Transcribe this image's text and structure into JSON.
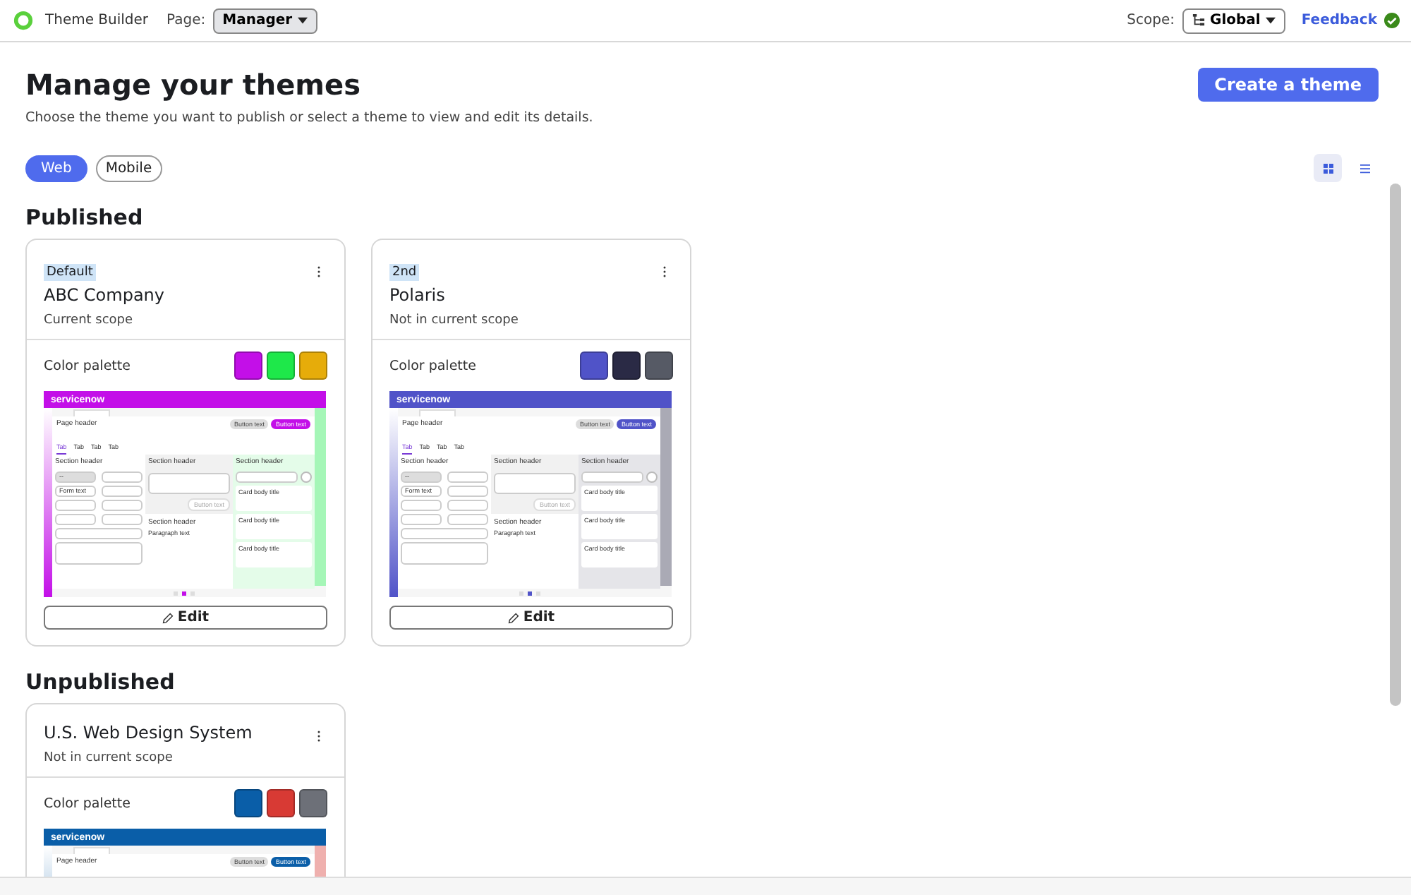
{
  "topbar": {
    "app_name": "Theme Builder",
    "page_label": "Page:",
    "page_value": "Manager",
    "scope_label": "Scope:",
    "scope_value": "Global",
    "feedback": "Feedback"
  },
  "header": {
    "title": "Manage your themes",
    "subtitle": "Choose the theme you want to publish or select a theme to view and edit its details.",
    "create_button": "Create a theme"
  },
  "platform_tabs": [
    {
      "label": "Web",
      "selected": true
    },
    {
      "label": "Mobile",
      "selected": false
    }
  ],
  "view_toggle": [
    {
      "kind": "grid",
      "selected": true
    },
    {
      "kind": "list",
      "selected": false
    }
  ],
  "sections": [
    {
      "title": "Published",
      "themes": [
        {
          "badge": "Default",
          "name": "ABC Company",
          "scope": "Current scope",
          "palette_label": "Color palette",
          "palette": [
            {
              "color": "#c30fe8"
            },
            {
              "color": "#1ee84a"
            },
            {
              "color": "#e6ac0a"
            }
          ],
          "preview": {
            "brand": "servicenow",
            "page_header": "Page header",
            "header_buttons": [
              "Button text",
              "Button text"
            ],
            "tabs": [
              "Tab",
              "Tab",
              "Tab",
              "Tab"
            ],
            "section_headers": [
              "Section header",
              "Section header",
              "Section header",
              "Section header"
            ],
            "field_value": "--",
            "form_text": "Form text",
            "button": "Button text",
            "paragraph": "Paragraph text",
            "card_titles": [
              "Card body title",
              "Card body title",
              "Card body title"
            ]
          },
          "edit": "Edit"
        },
        {
          "badge": "2nd",
          "name": "Polaris",
          "scope": "Not in current scope",
          "palette_label": "Color palette",
          "palette": [
            {
              "color": "#5053c8"
            },
            {
              "color": "#2a2a45"
            },
            {
              "color": "#565a65"
            }
          ],
          "preview": {
            "brand": "servicenow",
            "page_header": "Page header",
            "header_buttons": [
              "Button text",
              "Button text"
            ],
            "tabs": [
              "Tab",
              "Tab",
              "Tab",
              "Tab"
            ],
            "section_headers": [
              "Section header",
              "Section header",
              "Section header",
              "Section header"
            ],
            "field_value": "--",
            "form_text": "Form text",
            "button": "Button text",
            "paragraph": "Paragraph text",
            "card_titles": [
              "Card body title",
              "Card body title",
              "Card body title"
            ]
          },
          "edit": "Edit"
        }
      ]
    },
    {
      "title": "Unpublished",
      "themes": [
        {
          "name": "U.S. Web Design System",
          "scope": "Not in current scope",
          "palette_label": "Color palette",
          "palette": [
            {
              "color": "#0a5ea8"
            },
            {
              "color": "#d83a34"
            },
            {
              "color": "#6d7078"
            }
          ],
          "preview": {
            "brand": "servicenow",
            "page_header": "Page header",
            "header_buttons": [
              "Button text",
              "Button text"
            ]
          }
        }
      ]
    }
  ]
}
